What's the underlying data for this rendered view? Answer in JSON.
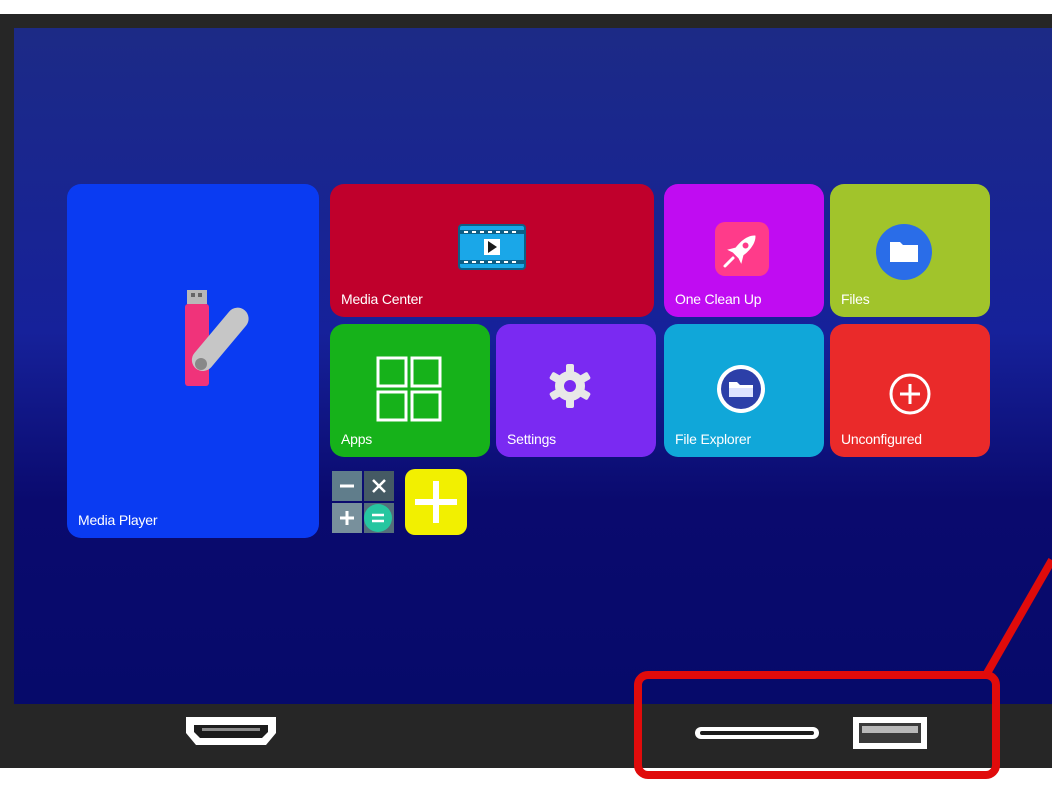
{
  "tiles": {
    "media_player": "Media Player",
    "media_center": "Media Center",
    "one_clean_up": "One Clean Up",
    "files": "Files",
    "apps": "Apps",
    "settings": "Settings",
    "file_explorer": "File Explorer",
    "unconfigured": "Unconfigured"
  },
  "icons": {
    "media_player": "usb-drive-icon",
    "media_center": "film-play-icon",
    "one_clean_up": "rocket-icon",
    "files": "folder-icon",
    "apps": "grid-icon",
    "settings": "gear-icon",
    "file_explorer": "folder-circle-icon",
    "unconfigured": "plus-circle-icon",
    "calculator": "calculator-icon",
    "add": "add-icon"
  },
  "ports": [
    "hdmi-port",
    "sd-card-slot",
    "usb-port"
  ],
  "colors": {
    "media_player": "#0a3bf2",
    "media_center": "#c0002c",
    "one_clean_up": "#c00cf2",
    "files": "#a1c42b",
    "apps": "#16b21a",
    "settings": "#7a2af2",
    "file_explorer": "#10a7d9",
    "unconfigured": "#ea2a2a",
    "callout": "#e00b0b"
  }
}
